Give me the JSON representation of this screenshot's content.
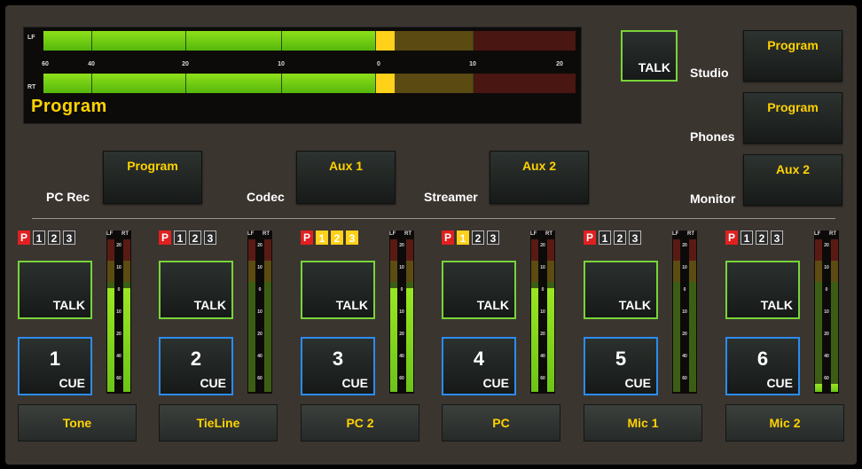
{
  "main_meter": {
    "title": "Program",
    "left_label": "LF",
    "right_label": "RT",
    "scale": [
      "60",
      "40",
      "20",
      "10",
      "0",
      "10",
      "20"
    ]
  },
  "talk_button": {
    "label": "TALK"
  },
  "outputs": [
    {
      "label": "Studio",
      "value": "Program"
    },
    {
      "label": "Phones",
      "value": "Program"
    },
    {
      "label": "Monitor",
      "value": "Aux 2"
    }
  ],
  "sends": [
    {
      "label": "PC Rec",
      "value": "Program"
    },
    {
      "label": "Codec",
      "value": "Aux 1"
    },
    {
      "label": "Streamer",
      "value": "Aux 2"
    }
  ],
  "channel_strip_labels": {
    "talk": "TALK",
    "cue": "CUE",
    "meter_left": "LF",
    "meter_right": "RT",
    "scale": [
      "20",
      "10",
      "0",
      "10",
      "20",
      "40",
      "60"
    ],
    "indicators": [
      "P",
      "1",
      "2",
      "3"
    ]
  },
  "channels": [
    {
      "number": "1",
      "name": "Tone",
      "active": [],
      "level_left": 0.68,
      "level_right": 0.68
    },
    {
      "number": "2",
      "name": "TieLine",
      "active": [],
      "level_left": 0.0,
      "level_right": 0.0
    },
    {
      "number": "3",
      "name": "PC 2",
      "active": [
        "1",
        "2",
        "3"
      ],
      "level_left": 0.68,
      "level_right": 0.68
    },
    {
      "number": "4",
      "name": "PC",
      "active": [
        "1"
      ],
      "level_left": 0.68,
      "level_right": 0.68
    },
    {
      "number": "5",
      "name": "Mic 1",
      "active": [],
      "level_left": 0.0,
      "level_right": 0.0
    },
    {
      "number": "6",
      "name": "Mic 2",
      "active": [],
      "level_left": 0.05,
      "level_right": 0.05
    }
  ],
  "colors": {
    "accent_yellow": "#ffd200",
    "talk_border": "#78d43a",
    "cue_border": "#2b8cf0",
    "meter_green": "#8ee01a",
    "indicator_red": "#e02020"
  }
}
